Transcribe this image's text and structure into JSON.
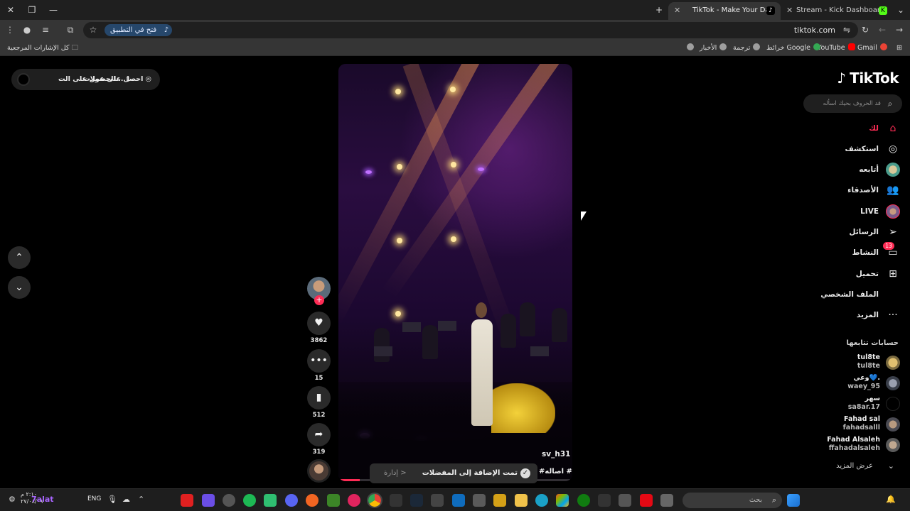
{
  "browser": {
    "tabs": [
      {
        "title": "TikTok - Make Your Day",
        "active": true
      },
      {
        "title": "Stream - Kick Dashboard",
        "active": false
      }
    ],
    "url": "tiktok.com",
    "open_in_app": "فتح في التطبيق",
    "bookmarks": [
      {
        "label": "كل الإشارات المرجعية"
      },
      {
        "label": "Gmail"
      },
      {
        "label": "YouTube"
      },
      {
        "label": "خرائط Google"
      },
      {
        "label": "ترجمة"
      },
      {
        "label": "الأخبار"
      }
    ]
  },
  "promo": {
    "label_coins": "احصل على عملات",
    "label_app": "الحصول على الت..."
  },
  "video": {
    "username": "sv_h31",
    "hashtag": "#اصاله #",
    "progress": 0.09,
    "actions": {
      "likes": "3862",
      "comments": "15",
      "saves": "512",
      "shares": "319"
    }
  },
  "toast": {
    "text": "تمت الإضافة إلى المفضلات",
    "link": "إدارة >"
  },
  "sidebar": {
    "logo": "TikTok",
    "search_placeholder": "قد الحروف بحيك اسأله",
    "nav": [
      {
        "label": "لك",
        "icon": "home-icon"
      },
      {
        "label": "استكشف",
        "icon": "compass-icon"
      },
      {
        "label": "أتابعه",
        "icon": "following-avatar-icon"
      },
      {
        "label": "الأصدقاء",
        "icon": "friends-icon"
      },
      {
        "label": "LIVE",
        "icon": "live-avatar-icon"
      },
      {
        "label": "الرسائل",
        "icon": "messages-icon"
      },
      {
        "label": "النشاط",
        "icon": "activity-icon",
        "badge": "13"
      },
      {
        "label": "تحميل",
        "icon": "upload-icon"
      },
      {
        "label": "الملف الشخصي",
        "icon": "profile-icon"
      },
      {
        "label": "المزيد",
        "icon": "more-icon"
      }
    ],
    "following_heading": "حسابات تتابعها",
    "accounts": [
      {
        "name": "tul8te",
        "handle": "tul8te"
      },
      {
        "name": "وعي💙.",
        "handle": "waey_95"
      },
      {
        "name": "سهر",
        "handle": "sa8ar.17"
      },
      {
        "name": "Fahad sal",
        "handle": "fahadsalll"
      },
      {
        "name": "Fahad Alsaleh",
        "handle": "ffahadalsaleh"
      }
    ],
    "see_more": "عرض المزيد"
  },
  "taskbar": {
    "time": "٢:١٠ م",
    "date": "٢٧/٠٨/٠٩",
    "weather": "7alat",
    "language": "ENG",
    "search_placeholder": "بحث"
  },
  "colors": {
    "brand": "#fe2c55",
    "page_bg": "#000000",
    "sidebar_bg": "#000000"
  }
}
